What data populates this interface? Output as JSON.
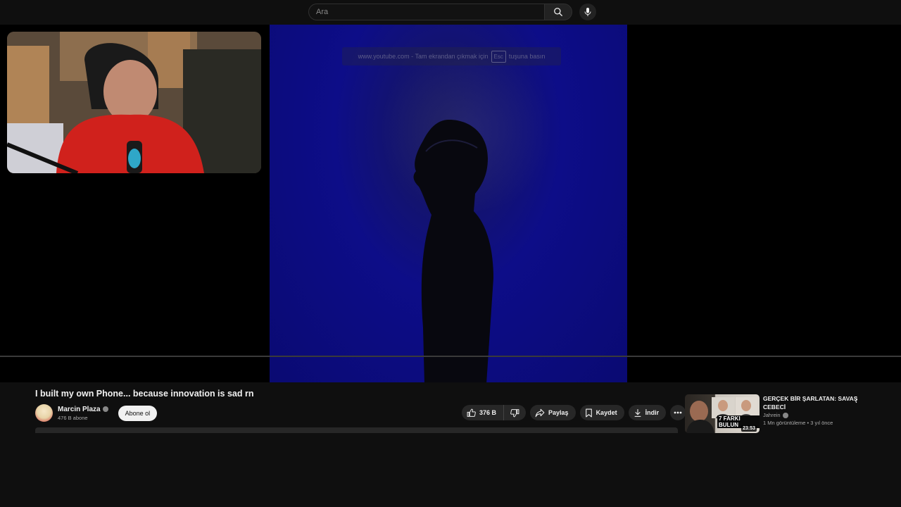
{
  "search": {
    "placeholder": "Ara"
  },
  "fullscreen_hint": {
    "text_before": "www.youtube.com - Tam ekrandan çıkmak için",
    "key": "Esc",
    "text_after": "tuşuna basın"
  },
  "video": {
    "title": "I built my own Phone... because innovation is sad rn",
    "channel": "Marcin Plaza",
    "subscribers": "476 B abone",
    "subscribe_label": "Abone ol",
    "likes": "376 B",
    "share_label": "Paylaş",
    "save_label": "Kaydet",
    "download_label": "İndir"
  },
  "recommendation": {
    "title": "GERÇEK BİR ŞARLATAN: SAVAŞ CEBECİ",
    "channel": "Jahrein",
    "stats": "1 Mn görüntüleme • 3 yıl önce",
    "duration": "23:53",
    "thumb_text": "7 FARKI BULUN"
  },
  "colors": {
    "background": "#0f0f0f",
    "video_blue": "#0d0d88",
    "pill": "#272727"
  }
}
